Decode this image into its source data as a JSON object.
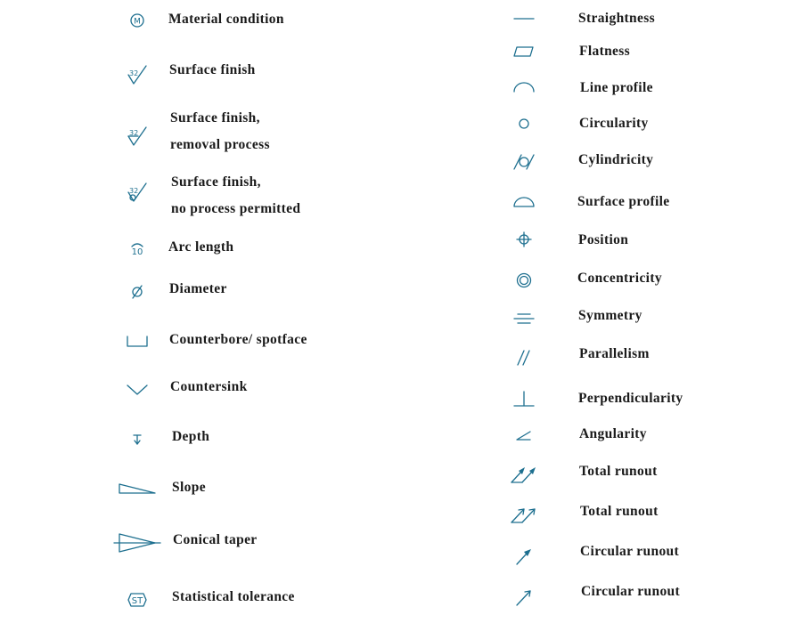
{
  "accent_color": "#1d6f8f",
  "left_column": [
    {
      "icon": "material-condition-icon",
      "lines": [
        "Material condition"
      ],
      "glyph_text": "M"
    },
    {
      "icon": "surface-finish-icon",
      "lines": [
        "Surface finish"
      ],
      "glyph_text": "32"
    },
    {
      "icon": "surface-finish-removal-icon",
      "lines": [
        "Surface finish,",
        "removal process"
      ],
      "glyph_text": "32"
    },
    {
      "icon": "surface-finish-no-process-icon",
      "lines": [
        "Surface finish,",
        "no process permitted"
      ],
      "glyph_text": "32"
    },
    {
      "icon": "arc-length-icon",
      "lines": [
        "Arc length"
      ],
      "glyph_text": "10"
    },
    {
      "icon": "diameter-icon",
      "lines": [
        "Diameter"
      ],
      "glyph_text": "Ø"
    },
    {
      "icon": "counterbore-icon",
      "lines": [
        "Counterbore/ spotface"
      ]
    },
    {
      "icon": "countersink-icon",
      "lines": [
        "Countersink"
      ]
    },
    {
      "icon": "depth-icon",
      "lines": [
        "Depth"
      ]
    },
    {
      "icon": "slope-icon",
      "lines": [
        "Slope"
      ]
    },
    {
      "icon": "conical-taper-icon",
      "lines": [
        "Conical taper"
      ]
    },
    {
      "icon": "statistical-tolerance-icon",
      "lines": [
        "Statistical tolerance"
      ],
      "glyph_text": "ST"
    }
  ],
  "right_column": [
    {
      "icon": "straightness-icon",
      "lines": [
        "Straightness"
      ]
    },
    {
      "icon": "flatness-icon",
      "lines": [
        "Flatness"
      ]
    },
    {
      "icon": "line-profile-icon",
      "lines": [
        "Line profile"
      ]
    },
    {
      "icon": "circularity-icon",
      "lines": [
        "Circularity"
      ]
    },
    {
      "icon": "cylindricity-icon",
      "lines": [
        "Cylindricity"
      ]
    },
    {
      "icon": "surface-profile-icon",
      "lines": [
        "Surface profile"
      ]
    },
    {
      "icon": "position-icon",
      "lines": [
        "Position"
      ]
    },
    {
      "icon": "concentricity-icon",
      "lines": [
        "Concentricity"
      ]
    },
    {
      "icon": "symmetry-icon",
      "lines": [
        "Symmetry"
      ]
    },
    {
      "icon": "parallelism-icon",
      "lines": [
        "Parallelism"
      ]
    },
    {
      "icon": "perpendicularity-icon",
      "lines": [
        "Perpendicularity"
      ]
    },
    {
      "icon": "angularity-icon",
      "lines": [
        "Angularity"
      ]
    },
    {
      "icon": "total-runout-filled-icon",
      "lines": [
        "Total runout"
      ]
    },
    {
      "icon": "total-runout-open-icon",
      "lines": [
        "Total runout"
      ]
    },
    {
      "icon": "circular-runout-filled-icon",
      "lines": [
        "Circular runout"
      ]
    },
    {
      "icon": "circular-runout-open-icon",
      "lines": [
        "Circular runout"
      ]
    }
  ]
}
